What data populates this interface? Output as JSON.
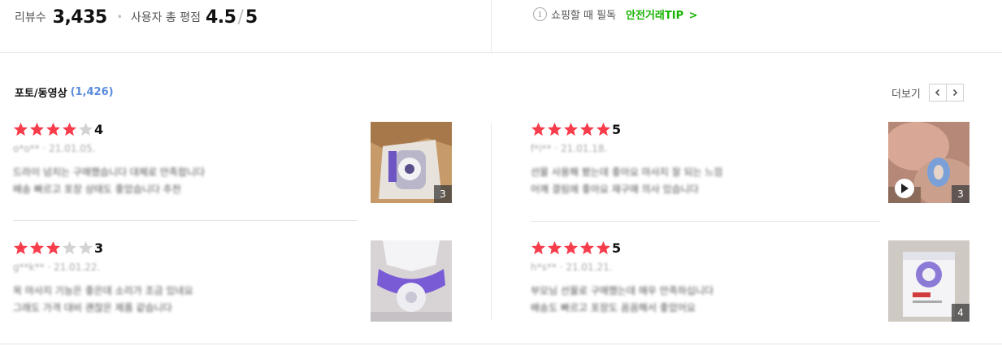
{
  "summary": {
    "review_label": "리뷰수",
    "review_count": "3,435",
    "separator": "•",
    "rating_label": "사용자 총 평점",
    "rating_value": "4.5",
    "rating_slash": "/",
    "rating_max": "5"
  },
  "tip": {
    "icon": "info-icon",
    "text": "쇼핑할 때 필독",
    "link_label": "안전거래TIP",
    "link_arrow": ">"
  },
  "photo_section": {
    "title": "포토/동영상",
    "count": "(1,426)",
    "more_label": "더보기",
    "prev_icon": "chevron-left-icon",
    "next_icon": "chevron-right-icon"
  },
  "colors": {
    "star_on": "#f73d4c",
    "star_off": "#d3d3d3",
    "tip_green": "#16b400",
    "count_blue": "#5a8be0"
  },
  "reviews": [
    {
      "stars": 4,
      "score": "4",
      "author": "o*o**",
      "date": "21.01.05.",
      "line1": "드라이 넘치는 구매했습니다 대체로 만족합니다",
      "line2": "배송 빠르고 포장 상태도 좋았습니다 추천",
      "photo_count": "3",
      "video": false
    },
    {
      "stars": 5,
      "score": "5",
      "author": "f*i**",
      "date": "21.01.18.",
      "line1": "선물 사용해 봤는데 좋아요 마사지 잘 되는 느낌",
      "line2": "어깨 결림에 좋아요 재구매 의사 있습니다",
      "photo_count": "3",
      "video": true
    },
    {
      "stars": 3,
      "score": "3",
      "author": "g**k**",
      "date": "21.01.22.",
      "line1": "목 마사지 기능은 좋은데 소리가 조금 있네요",
      "line2": "그래도 가격 대비 괜찮은 제품 같습니다",
      "photo_count": "",
      "video": false
    },
    {
      "stars": 5,
      "score": "5",
      "author": "h*s**",
      "date": "21.01.21.",
      "line1": "부모님 선물로 구매했는데 매우 만족하십니다",
      "line2": "배송도 빠르고 포장도 꼼꼼해서 좋았어요",
      "photo_count": "4",
      "video": false
    }
  ]
}
